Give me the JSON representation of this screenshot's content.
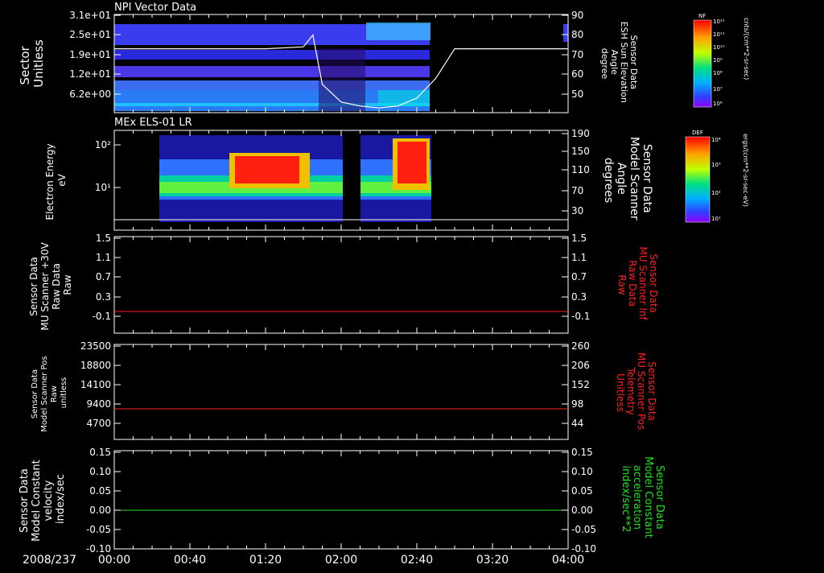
{
  "date_label": "2008/237",
  "time_ticks": [
    "00:00",
    "00:40",
    "01:20",
    "02:00",
    "02:40",
    "03:20",
    "04:00"
  ],
  "colors": {
    "background": "#000000",
    "axis": "#ffffff",
    "red_trace": "#ff2020",
    "green_trace": "#20e020"
  },
  "panels": [
    {
      "id": "npi",
      "title": "NPI Vector Data",
      "left_label": [
        "Sector",
        "Unitless"
      ],
      "left_ticks": [
        "3.1e+01",
        "2.5e+01",
        "1.9e+01",
        "1.2e+01",
        "6.2e+00"
      ],
      "right_label": [
        "Sensor Data",
        "ESH Sun Elevation",
        "Angle",
        "degree"
      ],
      "right_ticks": [
        "90",
        "80",
        "70",
        "60",
        "50"
      ],
      "colorbar": {
        "label": "NF",
        "unit": "cnts/(cm**2-sr-sec)",
        "ticks": [
          "10¹²",
          "10¹¹",
          "10¹⁰",
          "10⁹",
          "10⁸",
          "10⁷",
          "10⁶"
        ]
      }
    },
    {
      "id": "els",
      "title": "MEx ELS-01 LR",
      "left_label": [
        "Electron Energy",
        "eV"
      ],
      "left_ticks": [
        "10²",
        "10¹"
      ],
      "right_label": [
        "Sensor Data",
        "Model Scanner",
        "Angle",
        "degrees"
      ],
      "right_ticks": [
        "190",
        "150",
        "110",
        "70",
        "30"
      ],
      "colorbar": {
        "label": "DEF",
        "unit": "ergs/(cm**2-sr-sec-eV)",
        "ticks": [
          "10⁴",
          "10³",
          "10²",
          "10¹"
        ]
      }
    },
    {
      "id": "mu-raw",
      "left_label": [
        "Sensor Data",
        "MU Scanner +30V",
        "Raw Data",
        "Raw"
      ],
      "left_ticks": [
        "1.5",
        "1.1",
        "0.7",
        "0.3",
        "-0.1"
      ],
      "right_label": [
        "Sensor Data",
        "MU Scanner Inf",
        "Raw Data",
        "Raw"
      ],
      "right_ticks": [
        "1.5",
        "1.1",
        "0.7",
        "0.3",
        "-0.1"
      ]
    },
    {
      "id": "pos",
      "left_label": [
        "Sensor Data",
        "Model Scanner Pos",
        "Raw",
        "unitless"
      ],
      "left_ticks": [
        "23500",
        "18800",
        "14100",
        "9400",
        "4700"
      ],
      "right_label": [
        "Sensor Data",
        "MU Scanner Pos",
        "Telemetry",
        "Unitless"
      ],
      "right_ticks": [
        "260",
        "206",
        "152",
        "98",
        "44"
      ]
    },
    {
      "id": "vel",
      "left_label": [
        "Sensor Data",
        "Model Constant",
        "velocity",
        "index/sec"
      ],
      "left_ticks": [
        "0.15",
        "0.10",
        "0.05",
        "0.00",
        "-0.05",
        "-0.10"
      ],
      "right_label": [
        "Sensor Data",
        "Model Constant",
        "acceleration",
        "index/sec**2"
      ],
      "right_ticks": [
        "0.15",
        "0.10",
        "0.05",
        "0.00",
        "-0.05",
        "-0.10"
      ]
    }
  ],
  "chart_data": [
    {
      "type": "heatmap",
      "title": "NPI Vector Data",
      "ylabel": "Sector Unitless",
      "y_ticks": [
        31,
        25,
        19,
        12,
        6.2
      ],
      "overlay_series": {
        "name": "ESH Sun Elevation Angle",
        "unit": "degree",
        "x": [
          "00:00",
          "00:20",
          "00:40",
          "01:00",
          "01:20",
          "01:40",
          "01:45",
          "01:50",
          "02:00",
          "02:10",
          "02:20",
          "02:30",
          "02:40",
          "02:50",
          "03:00",
          "03:20",
          "03:40",
          "04:00"
        ],
        "y": [
          73,
          73,
          73,
          73,
          73,
          74,
          80,
          55,
          46,
          44,
          43,
          44,
          48,
          58,
          73,
          73,
          73,
          73
        ]
      },
      "data_extent": [
        "00:00",
        "02:45"
      ]
    },
    {
      "type": "heatmap",
      "title": "MEx ELS-01 LR",
      "ylabel": "Electron Energy eV",
      "yscale": "log",
      "data_extent": [
        "00:40",
        "02:45"
      ],
      "overlay_series": {
        "name": "Model Scanner Angle",
        "unit": "degrees",
        "x": [
          "00:00",
          "04:00"
        ],
        "y": [
          20,
          20
        ]
      }
    },
    {
      "type": "line",
      "series": [
        {
          "name": "MU Scanner +30V Raw",
          "x": [
            "00:00",
            "04:00"
          ],
          "y": [
            0,
            0
          ]
        }
      ],
      "ylim": [
        -0.25,
        1.5
      ]
    },
    {
      "type": "line",
      "series": [
        {
          "name": "Model Scanner Pos Raw",
          "x": [
            "00:00",
            "04:00"
          ],
          "y": [
            8300,
            8300
          ]
        }
      ],
      "ylim": [
        2000,
        23500
      ]
    },
    {
      "type": "line",
      "series": [
        {
          "name": "Model Constant velocity",
          "x": [
            "00:00",
            "04:00"
          ],
          "y": [
            0.0,
            0.0
          ]
        }
      ],
      "ylim": [
        -0.1,
        0.15
      ]
    }
  ]
}
